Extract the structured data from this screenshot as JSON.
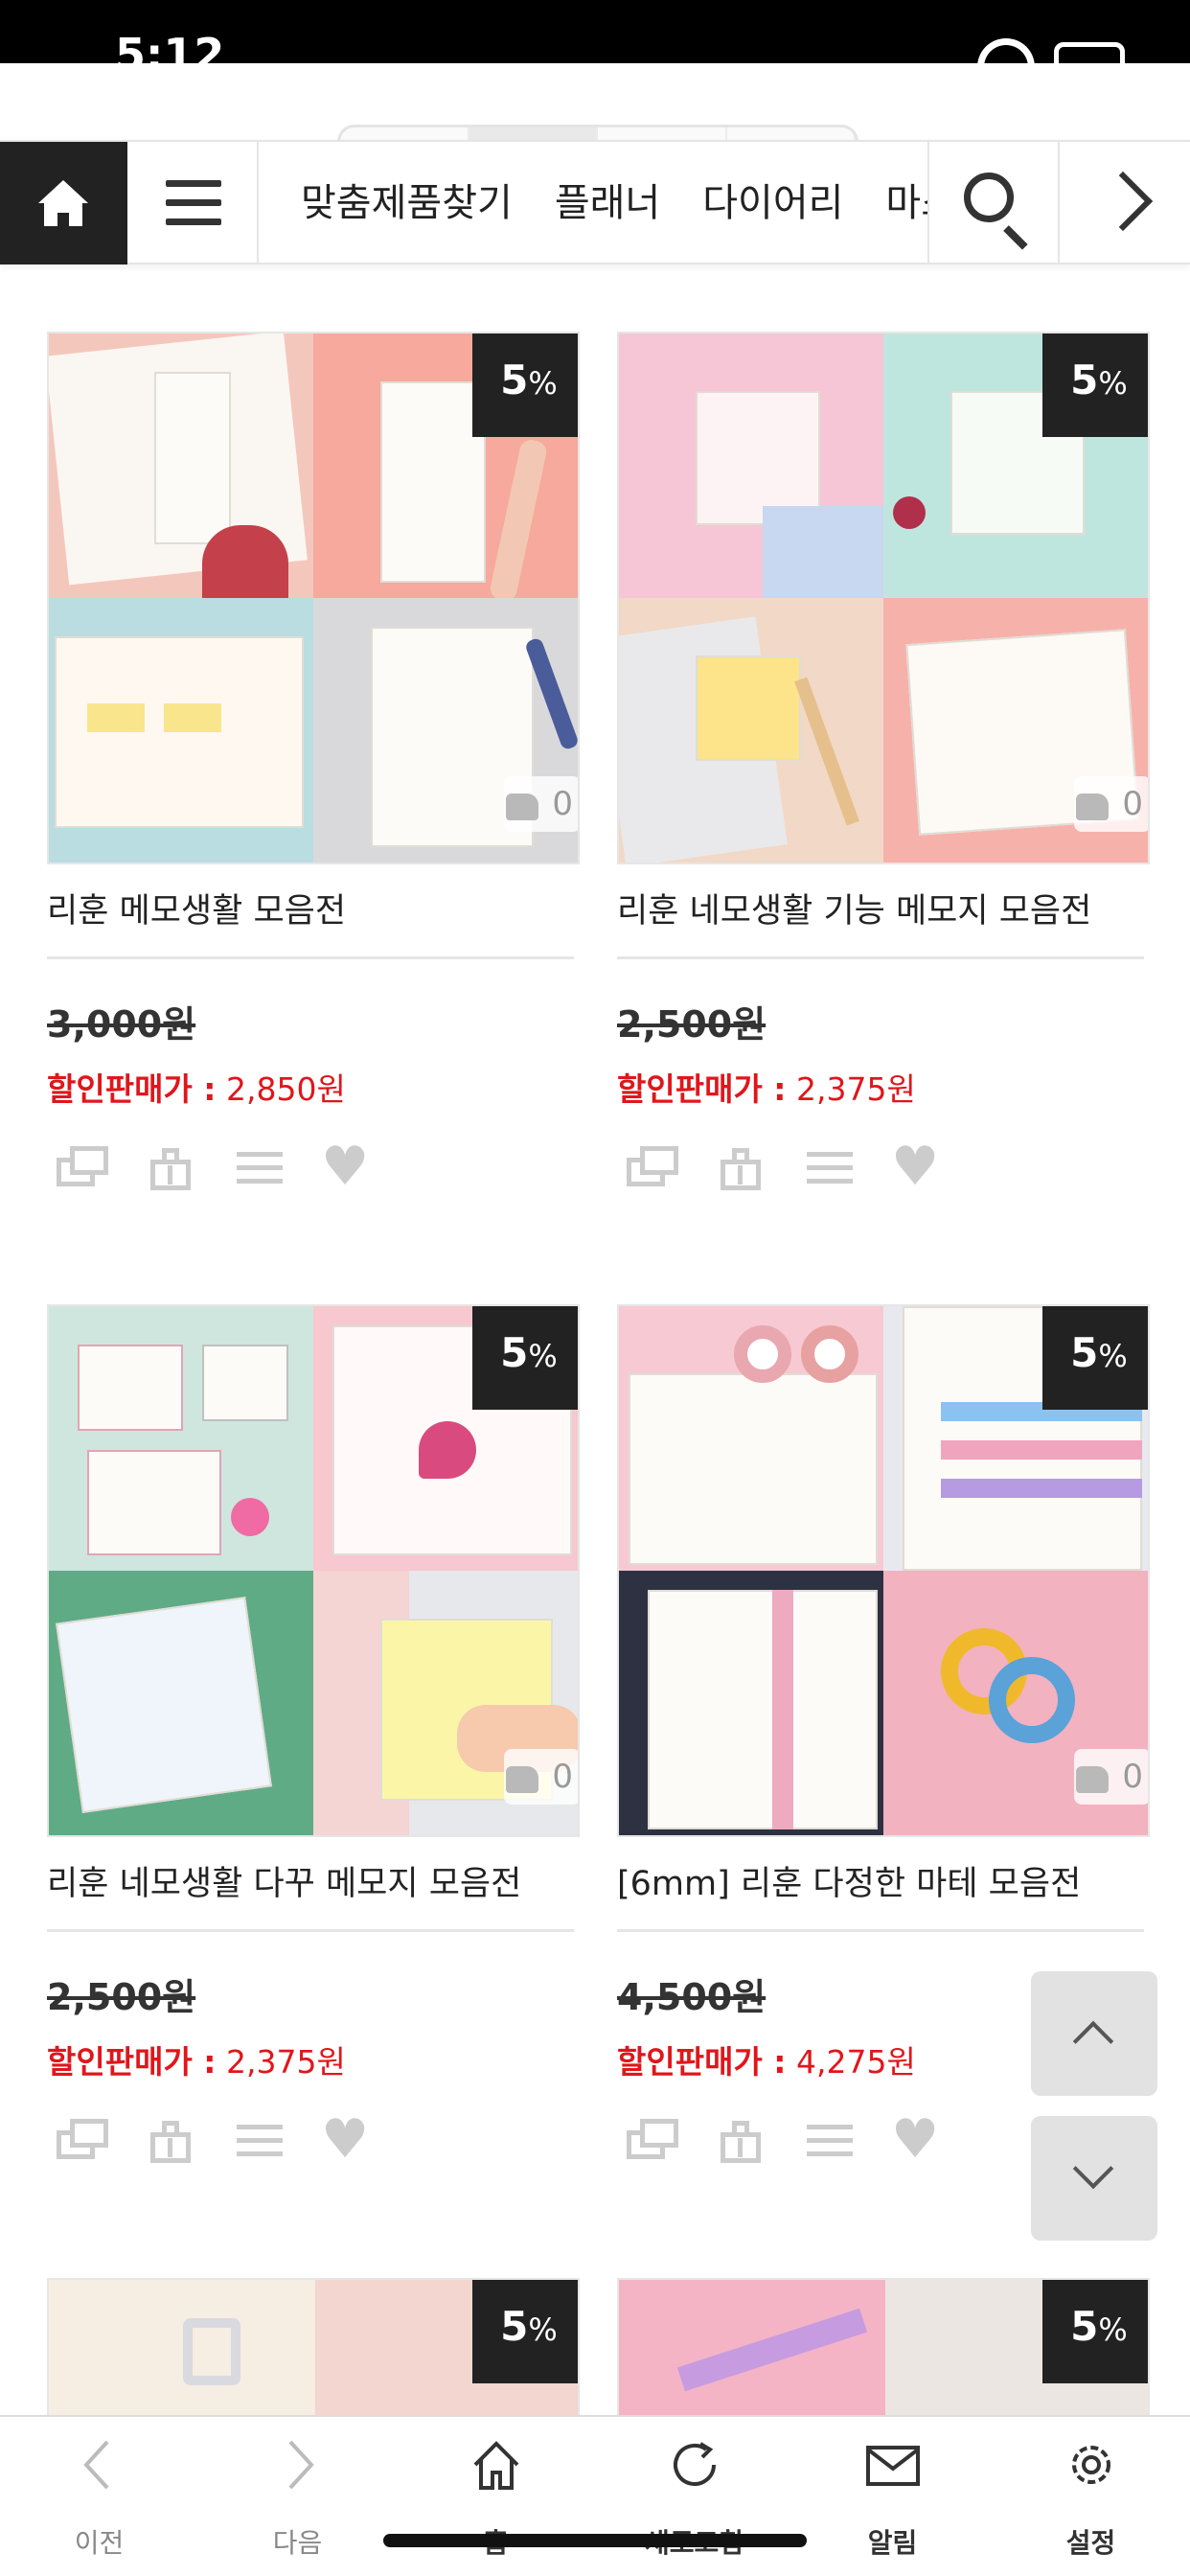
{
  "status": {
    "time": "5:12"
  },
  "nav": {
    "categories": [
      "맞춤제품찾기",
      "플래너",
      "다이어리",
      "마스킹테이프"
    ]
  },
  "products": [
    {
      "name": "리훈 메모생활 모음전",
      "discount_num": "5",
      "discount_pct": "%",
      "likes": "0",
      "original_price": "3,000원",
      "sale_label": "할인판매가 :",
      "sale_price": "2,850원"
    },
    {
      "name": "리훈 네모생활 기능 메모지 모음전",
      "discount_num": "5",
      "discount_pct": "%",
      "likes": "0",
      "original_price": "2,500원",
      "sale_label": "할인판매가 :",
      "sale_price": "2,375원"
    },
    {
      "name": "리훈 네모생활 다꾸 메모지 모음전",
      "discount_num": "5",
      "discount_pct": "%",
      "likes": "0",
      "original_price": "2,500원",
      "sale_label": "할인판매가 :",
      "sale_price": "2,375원"
    },
    {
      "name": "[6mm] 리훈 다정한 마테 모음전",
      "discount_num": "5",
      "discount_pct": "%",
      "likes": "0",
      "original_price": "4,500원",
      "sale_label": "할인판매가 :",
      "sale_price": "4,275원"
    },
    {
      "discount_num": "5",
      "discount_pct": "%"
    },
    {
      "discount_num": "5",
      "discount_pct": "%"
    }
  ],
  "bottom_nav": [
    {
      "label": "이전",
      "icon": "chevron-left-icon"
    },
    {
      "label": "다음",
      "icon": "chevron-right-icon"
    },
    {
      "label": "홈",
      "icon": "home-icon"
    },
    {
      "label": "새로고침",
      "icon": "refresh-icon"
    },
    {
      "label": "알림",
      "icon": "mail-icon"
    },
    {
      "label": "설정",
      "icon": "gear-icon"
    }
  ],
  "colors": {
    "sale_red": "#e0161b",
    "badge_dark": "#222222",
    "icon_gray": "#cccccc"
  }
}
